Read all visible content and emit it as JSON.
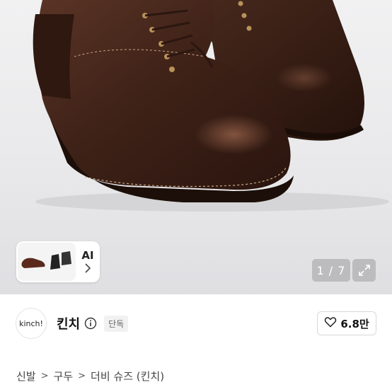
{
  "gallery": {
    "ai_label": "AI",
    "counter": "1 / 7",
    "icons": {
      "ai_chevron": "chevron-right-icon",
      "expand": "expand-icon"
    }
  },
  "seller": {
    "avatar_text": "kinch!",
    "name": "킨치",
    "badge": "단독",
    "like_count": "6.8만",
    "icons": {
      "info": "info-icon",
      "heart": "heart-icon"
    }
  },
  "breadcrumb": {
    "items": [
      "신발",
      "구두",
      "더비 슈즈 (킨치)"
    ],
    "separator": ">"
  }
}
